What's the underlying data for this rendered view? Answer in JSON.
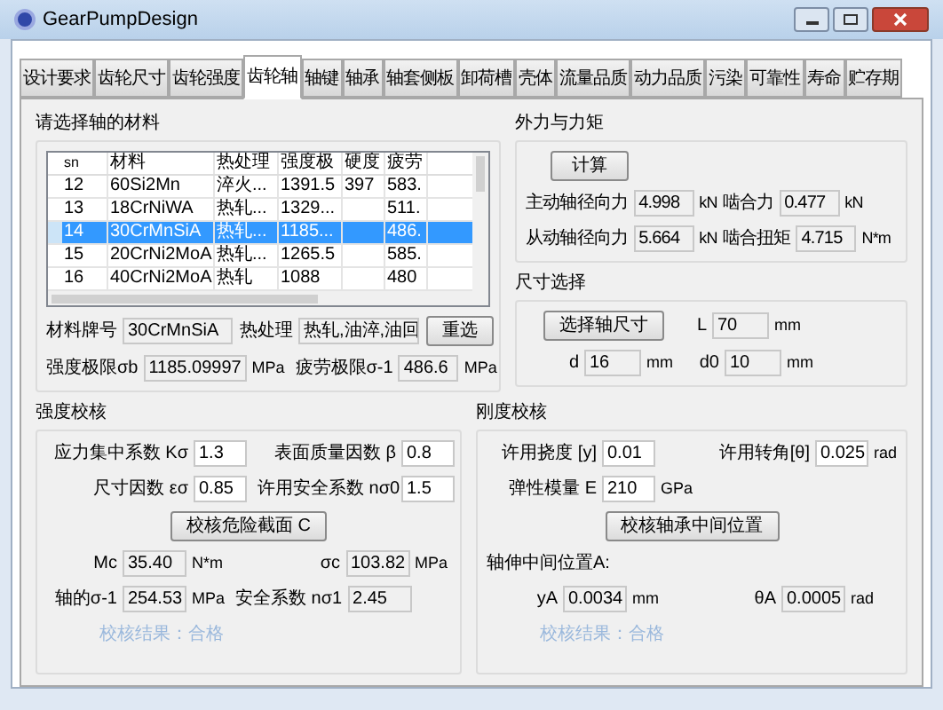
{
  "window": {
    "title": "GearPumpDesign"
  },
  "tabs": [
    {
      "label": "设计要求",
      "selected": false
    },
    {
      "label": "齿轮尺寸",
      "selected": false
    },
    {
      "label": "齿轮强度",
      "selected": false
    },
    {
      "label": "齿轮轴",
      "selected": true
    },
    {
      "label": "轴键",
      "selected": false
    },
    {
      "label": "轴承",
      "selected": false
    },
    {
      "label": "轴套侧板",
      "selected": false
    },
    {
      "label": "卸荷槽",
      "selected": false
    },
    {
      "label": "壳体",
      "selected": false
    },
    {
      "label": "流量品质",
      "selected": false
    },
    {
      "label": "动力品质",
      "selected": false
    },
    {
      "label": "污染",
      "selected": false
    },
    {
      "label": "可靠性",
      "selected": false
    },
    {
      "label": "寿命",
      "selected": false
    },
    {
      "label": "贮存期",
      "selected": false
    }
  ],
  "material": {
    "title": "请选择轴的材料",
    "table": {
      "columns": [
        "sn",
        "材料",
        "热处理",
        "强度极",
        "硬度",
        "疲劳"
      ],
      "rows": [
        {
          "cells": [
            "12",
            "60Si2Mn",
            "淬火...",
            "1391.5",
            "397",
            "583."
          ],
          "selected": false
        },
        {
          "cells": [
            "13",
            "18CrNiWA",
            "热轧...",
            "1329...",
            "",
            "511."
          ],
          "selected": false
        },
        {
          "cells": [
            "14",
            "30CrMnSiA",
            "热轧...",
            "1185...",
            "",
            "486."
          ],
          "selected": true
        },
        {
          "cells": [
            "15",
            "20CrNi2MoA",
            "热轧...",
            "1265.5",
            "",
            "585."
          ],
          "selected": false
        },
        {
          "cells": [
            "16",
            "40CrNi2MoA",
            "热轧",
            "1088",
            "",
            "480"
          ],
          "selected": false
        }
      ]
    },
    "grade": {
      "label": "材料牌号",
      "value": "30CrMnSiA",
      "readonly": true
    },
    "treatment": {
      "label": "热处理",
      "value": "热轧,油淬,油回",
      "readonly": true
    },
    "reselect_button": "重选",
    "strength": {
      "label": "强度极限σb",
      "value": "1185.09997",
      "unit": "MPa",
      "readonly": true
    },
    "fatigue": {
      "label": "疲劳极限σ-1",
      "value": "486.6",
      "unit": "MPa",
      "readonly": true
    }
  },
  "forces": {
    "title": "外力与力矩",
    "calc_button": "计算",
    "rows": [
      [
        {
          "label": "主动轴径向力",
          "value": "4.998",
          "unit": "kN",
          "readonly": true
        },
        {
          "label": "啮合力",
          "value": "0.477",
          "unit": "kN",
          "readonly": true
        }
      ],
      [
        {
          "label": "从动轴径向力",
          "value": "5.664",
          "unit": "kN",
          "readonly": true
        },
        {
          "label": "啮合扭矩",
          "value": "4.715",
          "unit": "N*m",
          "readonly": true
        }
      ]
    ]
  },
  "size": {
    "title": "尺寸选择",
    "select_button": "选择轴尺寸",
    "L": {
      "label": "L",
      "value": "70",
      "unit": "mm",
      "readonly": true
    },
    "rows": [
      [
        {
          "label": "d",
          "value": "16",
          "unit": "mm",
          "readonly": true
        },
        {
          "label": "d0",
          "value": "10",
          "unit": "mm",
          "readonly": true
        }
      ]
    ]
  },
  "strength_check": {
    "title": "强度校核",
    "rows": [
      [
        {
          "label": "应力集中系数 Kσ",
          "value": "1.3",
          "readonly": false
        },
        {
          "label": "表面质量因数 β",
          "value": "0.8",
          "readonly": false
        }
      ],
      [
        {
          "label": "尺寸因数 εσ",
          "value": "0.85",
          "readonly": false
        },
        {
          "label": "许用安全系数 nσ0",
          "value": "1.5",
          "readonly": false
        }
      ]
    ],
    "button": "校核危险截面 C",
    "results": [
      [
        {
          "label": "Mc",
          "value": "35.40",
          "unit": "N*m",
          "readonly": true
        },
        {
          "label": "σc",
          "value": "103.82",
          "unit": "MPa",
          "readonly": true
        }
      ],
      [
        {
          "label": "轴的σ-1",
          "value": "254.53",
          "unit": "MPa",
          "readonly": true
        },
        {
          "label": "安全系数 nσ1",
          "value": "2.45",
          "readonly": true
        }
      ]
    ],
    "verdict": "校核结果：合格"
  },
  "stiffness_check": {
    "title": "刚度校核",
    "rows": [
      [
        {
          "label": "许用挠度 [y]",
          "value": "0.01",
          "readonly": false
        },
        {
          "label": "许用转角[θ]",
          "value": "0.025",
          "unit": "rad",
          "readonly": false
        }
      ],
      [
        {
          "label": "弹性模量 E",
          "value": "210",
          "unit": "GPa",
          "readonly": false
        }
      ]
    ],
    "button": "校核轴承中间位置",
    "position_label": "轴伸中间位置A:",
    "results": [
      [
        {
          "label": "yA",
          "value": "0.0034",
          "unit": "mm",
          "readonly": true
        },
        {
          "label": "θA",
          "value": "0.0005",
          "unit": "rad",
          "readonly": true
        }
      ]
    ],
    "verdict": "校核结果：合格"
  }
}
